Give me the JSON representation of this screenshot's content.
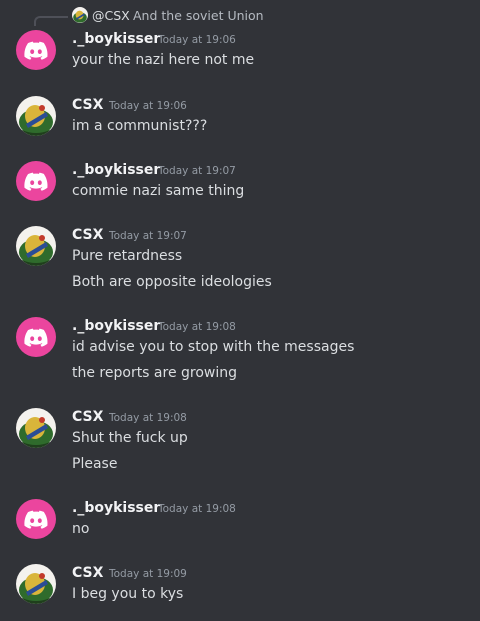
{
  "reply": {
    "author": "@CSX",
    "text": "And the soviet Union"
  },
  "colors": {
    "background": "#313338",
    "discord_avatar": "#eb459e",
    "username": "#f2f3f5",
    "timestamp": "#949ba4",
    "message_text": "#dbdee1"
  },
  "messages": [
    {
      "author": "._boykisser",
      "time": "Today at 19:06",
      "avatar": "discord-logo-icon",
      "lines": [
        "your the nazi here not me"
      ]
    },
    {
      "author": "CSX",
      "time": "Today at 19:06",
      "avatar": "csx-profile-picture",
      "lines": [
        "im a communist???"
      ]
    },
    {
      "author": "._boykisser",
      "time": "Today at 19:07",
      "avatar": "discord-logo-icon",
      "lines": [
        "commie nazi same thing"
      ]
    },
    {
      "author": "CSX",
      "time": "Today at 19:07",
      "avatar": "csx-profile-picture",
      "lines": [
        "Pure retardness",
        "Both are opposite ideologies"
      ]
    },
    {
      "author": "._boykisser",
      "time": "Today at 19:08",
      "avatar": "discord-logo-icon",
      "lines": [
        "id advise you to stop with the messages",
        "the reports are growing"
      ]
    },
    {
      "author": "CSX",
      "time": "Today at 19:08",
      "avatar": "csx-profile-picture",
      "lines": [
        "Shut the fuck up",
        "Please"
      ]
    },
    {
      "author": "._boykisser",
      "time": "Today at 19:08",
      "avatar": "discord-logo-icon",
      "lines": [
        "no"
      ]
    },
    {
      "author": "CSX",
      "time": "Today at 19:09",
      "avatar": "csx-profile-picture",
      "lines": [
        "I beg you to kys"
      ]
    }
  ]
}
